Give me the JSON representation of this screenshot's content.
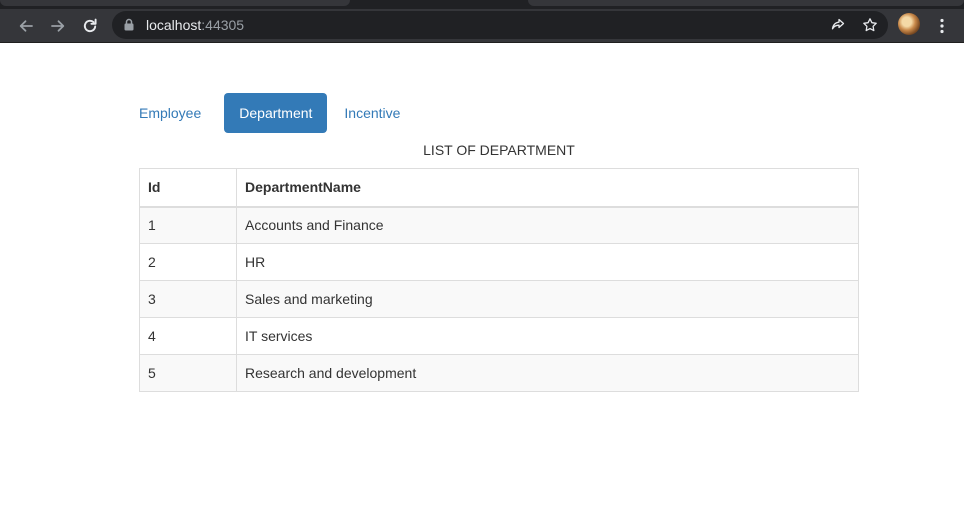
{
  "browser": {
    "url_host": "localhost",
    "url_port": ":44305",
    "icons": [
      "back-arrow-icon",
      "forward-arrow-icon",
      "reload-icon",
      "lock-icon",
      "share-icon",
      "star-icon",
      "profile-avatar",
      "more-vert-icon"
    ]
  },
  "nav": {
    "tabs": [
      {
        "label": "Employee",
        "active": false
      },
      {
        "label": "Department",
        "active": true
      },
      {
        "label": "Incentive",
        "active": false
      }
    ]
  },
  "table": {
    "caption": "LIST OF DEPARTMENT",
    "headers": {
      "id": "Id",
      "name": "DepartmentName"
    },
    "rows": [
      {
        "id": "1",
        "name": "Accounts and Finance"
      },
      {
        "id": "2",
        "name": "HR"
      },
      {
        "id": "3",
        "name": "Sales and marketing"
      },
      {
        "id": "4",
        "name": "IT services"
      },
      {
        "id": "5",
        "name": "Research and development"
      }
    ]
  },
  "colors": {
    "accent": "#337ab7",
    "chrome_dark": "#202124",
    "chrome_toolbar": "#35363a"
  }
}
